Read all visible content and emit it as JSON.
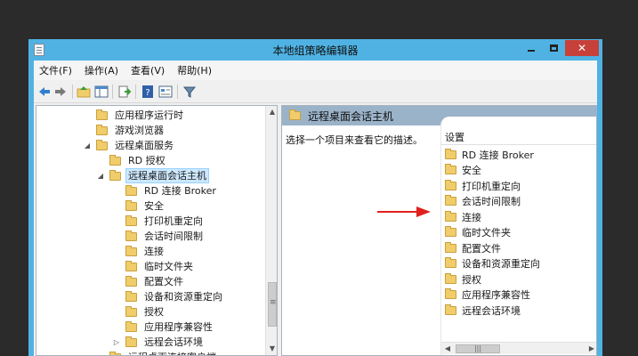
{
  "window": {
    "title": "本地组策略编辑器",
    "close_glyph": "✕"
  },
  "menu": {
    "items": [
      "文件(F)",
      "操作(A)",
      "查看(V)",
      "帮助(H)"
    ]
  },
  "toolbar": {
    "icons": [
      "back-arrow-icon",
      "forward-arrow-icon",
      "up-folder-icon",
      "show-hide-tree-icon",
      "export-list-icon",
      "help-icon",
      "properties-icon",
      "filter-icon"
    ]
  },
  "tree": {
    "items": [
      {
        "label": "应用程序运行时",
        "level": 4,
        "expander": "",
        "selected": false
      },
      {
        "label": "游戏浏览器",
        "level": 4,
        "expander": "",
        "selected": false
      },
      {
        "label": "远程桌面服务",
        "level": 4,
        "expander": "◢",
        "selected": false
      },
      {
        "label": "RD 授权",
        "level": 5,
        "expander": "",
        "selected": false
      },
      {
        "label": "远程桌面会话主机",
        "level": 5,
        "expander": "◢",
        "selected": true
      },
      {
        "label": "RD 连接 Broker",
        "level": 6,
        "expander": "",
        "selected": false
      },
      {
        "label": "安全",
        "level": 6,
        "expander": "",
        "selected": false
      },
      {
        "label": "打印机重定向",
        "level": 6,
        "expander": "",
        "selected": false
      },
      {
        "label": "会话时间限制",
        "level": 6,
        "expander": "",
        "selected": false
      },
      {
        "label": "连接",
        "level": 6,
        "expander": "",
        "selected": false
      },
      {
        "label": "临时文件夹",
        "level": 6,
        "expander": "",
        "selected": false
      },
      {
        "label": "配置文件",
        "level": 6,
        "expander": "",
        "selected": false
      },
      {
        "label": "设备和资源重定向",
        "level": 6,
        "expander": "",
        "selected": false
      },
      {
        "label": "授权",
        "level": 6,
        "expander": "",
        "selected": false
      },
      {
        "label": "应用程序兼容性",
        "level": 6,
        "expander": "",
        "selected": false
      },
      {
        "label": "远程会话环境",
        "level": 6,
        "expander": "▷",
        "selected": false
      },
      {
        "label": "远程桌面连接客户端",
        "level": 5,
        "expander": "▷",
        "selected": false
      }
    ]
  },
  "right_pane": {
    "header": "远程桌面会话主机",
    "description": "选择一个项目来查看它的描述。",
    "column_header": "设置",
    "items": [
      "RD 连接 Broker",
      "安全",
      "打印机重定向",
      "会话时间限制",
      "连接",
      "临时文件夹",
      "配置文件",
      "设备和资源重定向",
      "授权",
      "应用程序兼容性",
      "远程会话环境"
    ]
  },
  "colors": {
    "title_bar": "#4fb2e3",
    "close_button": "#c7413a",
    "selection": "#cde8ff",
    "pane_header": "#9bb3c9",
    "arrow": "#e0201c"
  }
}
